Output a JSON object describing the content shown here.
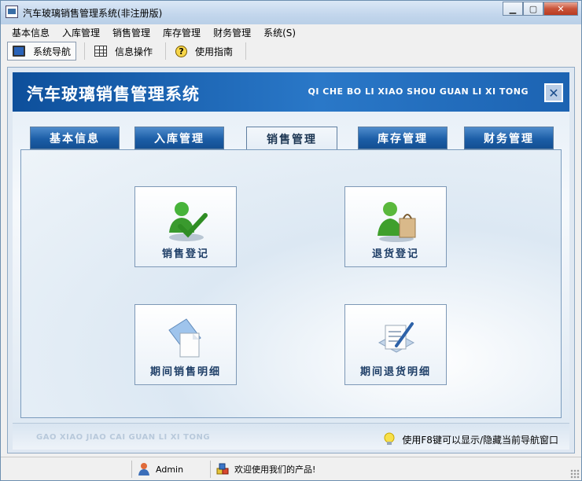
{
  "window": {
    "title": "汽车玻璃销售管理系统(非注册版)"
  },
  "menu": [
    "基本信息",
    "入库管理",
    "销售管理",
    "库存管理",
    "财务管理",
    "系统(S)"
  ],
  "toolbar": {
    "nav": "系统导航",
    "info": "信息操作",
    "guide": "使用指南"
  },
  "banner": {
    "title": "汽车玻璃销售管理系统",
    "subtitle": "QI CHE BO LI XIAO SHOU GUAN LI XI TONG"
  },
  "tabs": [
    "基本信息",
    "入库管理",
    "销售管理",
    "库存管理",
    "财务管理"
  ],
  "active_tab_index": 2,
  "functions": [
    {
      "label": "销售登记",
      "icon": "user-check-icon"
    },
    {
      "label": "退货登记",
      "icon": "user-bag-icon"
    },
    {
      "label": "期间销售明细",
      "icon": "documents-icon"
    },
    {
      "label": "期间退货明细",
      "icon": "document-edit-icon"
    }
  ],
  "footer": {
    "subtitle": "GAO XIAO JIAO CAI GUAN LI XI TONG",
    "tip": "使用F8键可以显示/隐藏当前导航窗口"
  },
  "status": {
    "user": "Admin",
    "message": "欢迎使用我们的产品!"
  },
  "colors": {
    "banner": "#1c63b2",
    "tab": "#1c5ea7",
    "label": "#1d3d66"
  }
}
